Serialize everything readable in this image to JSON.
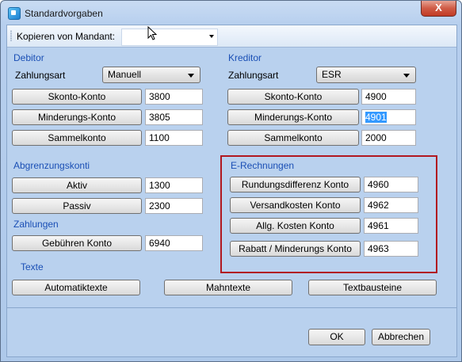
{
  "window": {
    "title": "Standardvorgaben",
    "close_label": "X"
  },
  "copybar": {
    "label": "Kopieren von Mandant:",
    "value": ""
  },
  "debitor": {
    "heading": "Debitor",
    "payment_label": "Zahlungsart",
    "payment_value": "Manuell",
    "skonto_label": "Skonto-Konto",
    "skonto_value": "3800",
    "minderung_label": "Minderungs-Konto",
    "minderung_value": "3805",
    "sammel_label": "Sammelkonto",
    "sammel_value": "1100"
  },
  "kreditor": {
    "heading": "Kreditor",
    "payment_label": "Zahlungsart",
    "payment_value": "ESR",
    "skonto_label": "Skonto-Konto",
    "skonto_value": "4900",
    "minderung_label": "Minderungs-Konto",
    "minderung_value": "4901",
    "sammel_label": "Sammelkonto",
    "sammel_value": "2000"
  },
  "abgrenzung": {
    "heading": "Abgrenzungskonti",
    "aktiv_label": "Aktiv",
    "aktiv_value": "1300",
    "passiv_label": "Passiv",
    "passiv_value": "2300"
  },
  "zahlungen": {
    "heading": "Zahlungen",
    "gebuehren_label": "Gebühren Konto",
    "gebuehren_value": "6940"
  },
  "erechnungen": {
    "heading": "E-Rechnungen",
    "rundung_label": "Rundungsdifferenz Konto",
    "rundung_value": "4960",
    "versand_label": "Versandkosten Konto",
    "versand_value": "4962",
    "allg_label": "Allg. Kosten Konto",
    "allg_value": "4961",
    "rabatt_label": "Rabatt / Minderungs Konto",
    "rabatt_value": "4963",
    "highlight_color": "#b11820"
  },
  "texte": {
    "heading": "Texte",
    "auto_label": "Automatiktexte",
    "mahn_label": "Mahntexte",
    "baustein_label": "Textbausteine"
  },
  "footer": {
    "ok_label": "OK",
    "cancel_label": "Abbrechen"
  }
}
